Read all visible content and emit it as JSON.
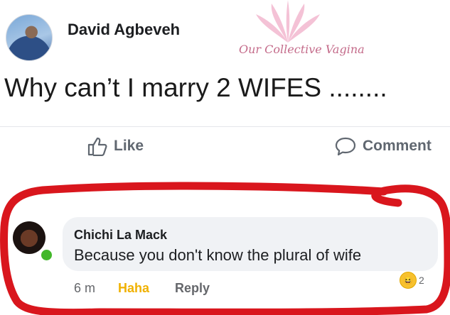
{
  "post": {
    "author": "David Agbeveh",
    "text": "Why can’t I marry 2 WIFES ........",
    "watermark": "Our Collective Vagina"
  },
  "actions": {
    "like_label": "Like",
    "comment_label": "Comment"
  },
  "comment": {
    "author": "Chichi La Mack",
    "text": "Because you don't know the plural of wife",
    "time": "6 m",
    "reaction_label": "Haha",
    "reply_label": "Reply",
    "reaction_count": "2",
    "reaction_icon": "haha-emoji-icon"
  },
  "colors": {
    "annotation_red": "#d9161d",
    "haha_yellow": "#f0b100",
    "online_green": "#42b72a"
  }
}
